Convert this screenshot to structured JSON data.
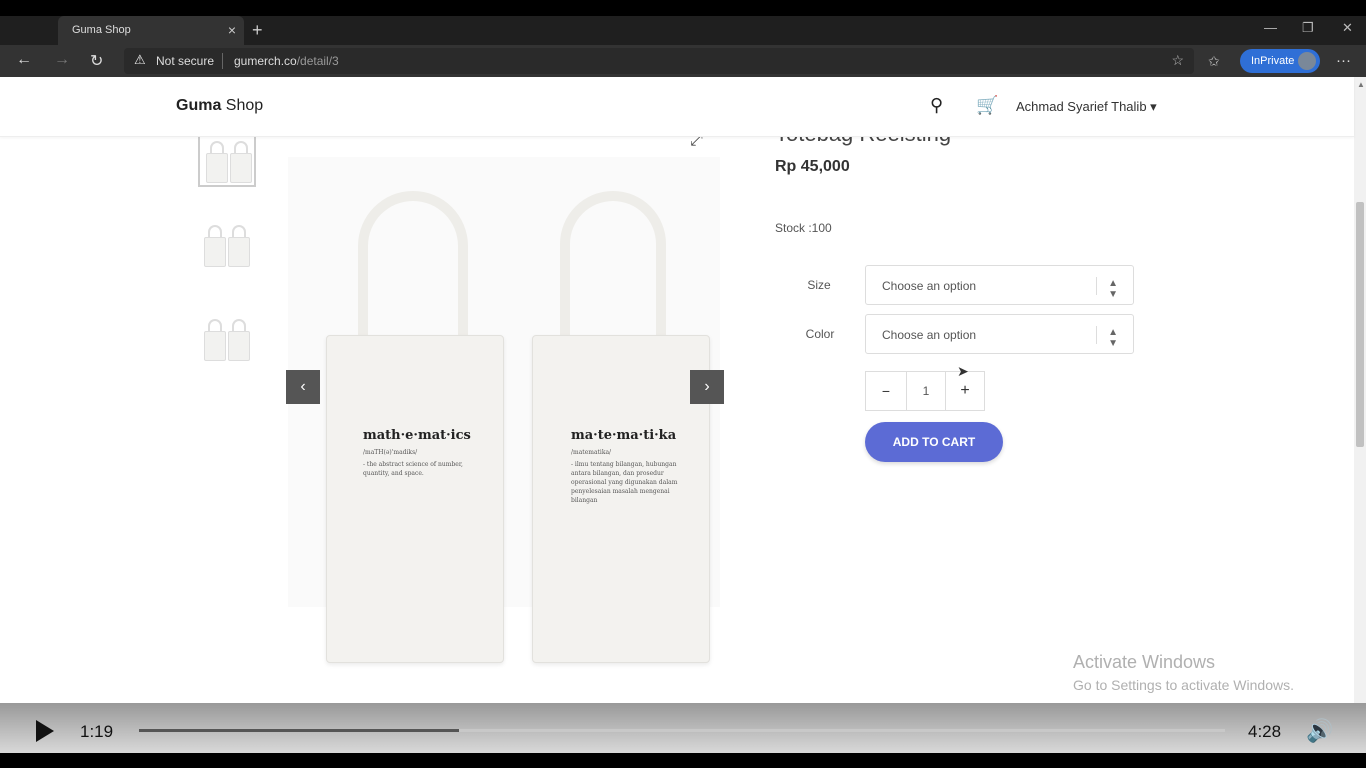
{
  "browser": {
    "tab_title": "Guma Shop",
    "tab_close": "×",
    "new_tab": "+",
    "security_label": "Not secure",
    "url_domain": "gumerch.co",
    "url_path": "/detail/3",
    "inprivate_label": "InPrivate"
  },
  "header": {
    "brand_bold": "Guma",
    "brand_rest": " Shop",
    "user_name": "Achmad Syarief Thalib"
  },
  "product": {
    "title": "Totebag Reelsting",
    "price": "Rp 45,000",
    "stock": "Stock :100",
    "size_label": "Size",
    "size_value": "Choose an option",
    "color_label": "Color",
    "color_value": "Choose an option",
    "quantity": "1",
    "qty_minus": "−",
    "qty_plus": "+",
    "add_to_cart": "ADD TO CART",
    "images": {
      "left_bag_title": "math·e·mat·ics",
      "left_bag_phon": "/maTH(ə)'madiks/",
      "left_bag_def": "- the abstract science of number, quantity, and space.",
      "right_bag_title": "ma·te·ma·ti·ka",
      "right_bag_phon": "/matematika/",
      "right_bag_def": "- ilmu tentang bilangan, hubungan antara bilangan, dan prosedur operasional yang digunakan dalam penyelesaian masalah mengenai bilangan"
    }
  },
  "watermark": {
    "line1": "Activate Windows",
    "line2": "Go to Settings to activate Windows."
  },
  "video": {
    "current_time": "1:19",
    "total_time": "4:28",
    "progress_fraction": 0.295
  },
  "colors": {
    "accent": "#5c6bd5",
    "inprivate": "#2f6fd6"
  }
}
